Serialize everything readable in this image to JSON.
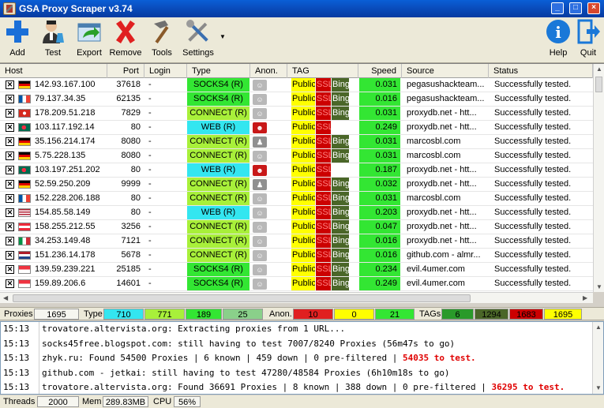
{
  "window": {
    "title": "GSA Proxy Scraper v3.74"
  },
  "toolbar": {
    "add": "Add",
    "test": "Test",
    "export": "Export",
    "remove": "Remove",
    "tools": "Tools",
    "settings": "Settings",
    "help": "Help",
    "quit": "Quit"
  },
  "columns": {
    "host": "Host",
    "port": "Port",
    "login": "Login",
    "type": "Type",
    "anon": "Anon.",
    "tag": "TAG",
    "speed": "Speed",
    "source": "Source",
    "status": "Status"
  },
  "tag_labels": {
    "public": "Public",
    "ssl": "SSL",
    "bing": "Bing"
  },
  "colors": {
    "socks": "#33e633",
    "connect": "#a8f03a",
    "web": "#33e6f0",
    "public": "#ffff00",
    "ssl": "#cc0000",
    "bing": "#4a6628",
    "speed": "#33e633"
  },
  "proxies": [
    {
      "flag": "de",
      "host": "142.93.167.100",
      "port": "37618",
      "login": "-",
      "type": "SOCKS4 (R)",
      "kind": "socks",
      "anon": "mask",
      "tags": [
        "public",
        "ssl",
        "bing"
      ],
      "speed": "0.031",
      "source": "pegasushackteam...",
      "status": "Successfully tested."
    },
    {
      "flag": "fr",
      "host": "79.137.34.35",
      "port": "62135",
      "login": "-",
      "type": "SOCKS4 (R)",
      "kind": "socks",
      "anon": "mask",
      "tags": [
        "public",
        "ssl",
        "bing"
      ],
      "speed": "0.016",
      "source": "pegasushackteam...",
      "status": "Successfully tested."
    },
    {
      "flag": "ch",
      "host": "178.209.51.218",
      "port": "7829",
      "login": "-",
      "type": "CONNECT (R)",
      "kind": "connect",
      "anon": "mask",
      "tags": [
        "public",
        "ssl",
        "bing"
      ],
      "speed": "0.031",
      "source": "proxydb.net - htt...",
      "status": "Successfully tested."
    },
    {
      "flag": "bd",
      "host": "103.117.192.14",
      "port": "80",
      "login": "-",
      "type": "WEB (R)",
      "kind": "web",
      "anon": "transparent",
      "tags": [
        "public",
        "ssl"
      ],
      "speed": "0.249",
      "source": "proxydb.net - htt...",
      "status": "Successfully tested."
    },
    {
      "flag": "de",
      "host": "35.156.214.174",
      "port": "8080",
      "login": "-",
      "type": "CONNECT (R)",
      "kind": "connect",
      "anon": "spy",
      "tags": [
        "public",
        "ssl",
        "bing"
      ],
      "speed": "0.031",
      "source": "marcosbl.com",
      "status": "Successfully tested."
    },
    {
      "flag": "de",
      "host": "5.75.228.135",
      "port": "8080",
      "login": "-",
      "type": "CONNECT (R)",
      "kind": "connect",
      "anon": "mask",
      "tags": [
        "public",
        "ssl",
        "bing"
      ],
      "speed": "0.031",
      "source": "marcosbl.com",
      "status": "Successfully tested."
    },
    {
      "flag": "bd",
      "host": "103.197.251.202",
      "port": "80",
      "login": "-",
      "type": "WEB (R)",
      "kind": "web",
      "anon": "transparent",
      "tags": [
        "public",
        "ssl"
      ],
      "speed": "0.187",
      "source": "proxydb.net - htt...",
      "status": "Successfully tested."
    },
    {
      "flag": "de",
      "host": "52.59.250.209",
      "port": "9999",
      "login": "-",
      "type": "CONNECT (R)",
      "kind": "connect",
      "anon": "spy",
      "tags": [
        "public",
        "ssl",
        "bing"
      ],
      "speed": "0.032",
      "source": "proxydb.net - htt...",
      "status": "Successfully tested."
    },
    {
      "flag": "fr",
      "host": "152.228.206.188",
      "port": "80",
      "login": "-",
      "type": "CONNECT (R)",
      "kind": "connect",
      "anon": "mask",
      "tags": [
        "public",
        "ssl",
        "bing"
      ],
      "speed": "0.031",
      "source": "marcosbl.com",
      "status": "Successfully tested."
    },
    {
      "flag": "us",
      "host": "154.85.58.149",
      "port": "80",
      "login": "-",
      "type": "WEB (R)",
      "kind": "web",
      "anon": "mask",
      "tags": [
        "public",
        "ssl",
        "bing"
      ],
      "speed": "0.203",
      "source": "proxydb.net - htt...",
      "status": "Successfully tested."
    },
    {
      "flag": "at",
      "host": "158.255.212.55",
      "port": "3256",
      "login": "-",
      "type": "CONNECT (R)",
      "kind": "connect",
      "anon": "mask",
      "tags": [
        "public",
        "ssl",
        "bing"
      ],
      "speed": "0.047",
      "source": "proxydb.net - htt...",
      "status": "Successfully tested."
    },
    {
      "flag": "it",
      "host": "34.253.149.48",
      "port": "7121",
      "login": "-",
      "type": "CONNECT (R)",
      "kind": "connect",
      "anon": "mask",
      "tags": [
        "public",
        "ssl",
        "bing"
      ],
      "speed": "0.016",
      "source": "proxydb.net - htt...",
      "status": "Successfully tested."
    },
    {
      "flag": "nl",
      "host": "151.236.14.178",
      "port": "5678",
      "login": "-",
      "type": "CONNECT (R)",
      "kind": "connect",
      "anon": "mask",
      "tags": [
        "public",
        "ssl",
        "bing"
      ],
      "speed": "0.016",
      "source": "github.com - almr...",
      "status": "Successfully tested."
    },
    {
      "flag": "sg",
      "host": "139.59.239.221",
      "port": "25185",
      "login": "-",
      "type": "SOCKS4 (R)",
      "kind": "socks",
      "anon": "mask",
      "tags": [
        "public",
        "ssl",
        "bing"
      ],
      "speed": "0.234",
      "source": "evil.4umer.com",
      "status": "Successfully tested."
    },
    {
      "flag": "sg",
      "host": "159.89.206.6",
      "port": "14601",
      "login": "-",
      "type": "SOCKS4 (R)",
      "kind": "socks",
      "anon": "mask",
      "tags": [
        "public",
        "ssl",
        "bing"
      ],
      "speed": "0.249",
      "source": "evil.4umer.com",
      "status": "Successfully tested."
    }
  ],
  "stats": {
    "proxies_label": "Proxies",
    "proxies": "1695",
    "type_label": "Type",
    "type_counts": [
      "710",
      "771",
      "189",
      "25"
    ],
    "anon_label": "Anon.",
    "anon_counts": [
      "10",
      "0",
      "21"
    ],
    "tags_label": "TAGs",
    "tag_counts": [
      "6",
      "1294",
      "1683",
      "1695"
    ]
  },
  "log": [
    {
      "time": "15:13",
      "msg": "trovatore.altervista.org: Extracting proxies from 1 URL...",
      "red": ""
    },
    {
      "time": "15:13",
      "msg": "socks45free.blogspot.com: still having to test 7007/8240 Proxies (56m47s to go)",
      "red": ""
    },
    {
      "time": "15:13",
      "msg": "zhyk.ru: Found 54500 Proxies | 6 known | 459 down | 0 pre-filtered | ",
      "red": "54035 to test."
    },
    {
      "time": "15:13",
      "msg": "github.com - jetkai: still having to test 47280/48584 Proxies (6h10m18s to go)",
      "red": ""
    },
    {
      "time": "15:13",
      "msg": "trovatore.altervista.org: Found 36691 Proxies | 8 known | 388 down | 0 pre-filtered | ",
      "red": "36295 to test."
    }
  ],
  "statusbar": {
    "threads_label": "Threads",
    "threads": "2000",
    "mem_label": "Mem",
    "mem": "289.83MB",
    "cpu_label": "CPU",
    "cpu": "56%"
  }
}
